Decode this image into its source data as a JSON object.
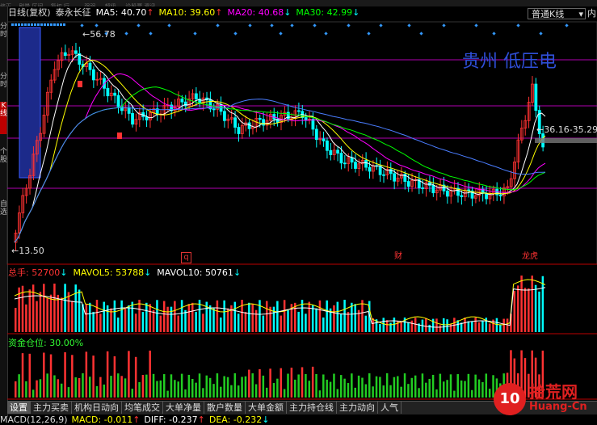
{
  "window": {
    "top_menu": [
      "修正",
      "…刷量",
      "区间…",
      "复权",
      "行…",
      "…",
      "强弱",
      "…",
      "超级",
      "…",
      "论股票",
      "资讯",
      "…"
    ]
  },
  "left_sidebar": {
    "items": [
      {
        "label": "分时",
        "active": false
      },
      {
        "label": "分时",
        "active": false
      },
      {
        "label": "K线",
        "active": true
      },
      {
        "label": "个股",
        "active": false
      },
      {
        "label": "自选",
        "active": false
      }
    ]
  },
  "header": {
    "period": "日线(复权)",
    "stock_name": "泰永长征",
    "ma5": {
      "label": "MA5:",
      "value": "40.70",
      "arrow": "↑",
      "color": "#ffffff"
    },
    "ma10": {
      "label": "MA10:",
      "value": "39.60",
      "arrow": "↑",
      "color": "#ffff00"
    },
    "ma20": {
      "label": "MA20:",
      "value": "40.68",
      "arrow": "↓",
      "color": "#ff00ff"
    },
    "ma30": {
      "label": "MA30:",
      "value": "42.99",
      "arrow": "↓",
      "color": "#00ff00"
    },
    "ktype_label": "普通K线",
    "right_button": "内"
  },
  "price_chart": {
    "high_label": "56.78",
    "low_label": "13.50",
    "range_label": "36.16-35.29",
    "overlay_text": "贵州  低压电",
    "markers": [
      "q",
      "财",
      "龙虎"
    ],
    "colors": {
      "up": "#ff3232",
      "down": "#00ffff",
      "ma5": "#ffffff",
      "ma10": "#ffff00",
      "ma20": "#ff00ff",
      "ma30": "#00ff00",
      "ma60": "#4a7dff",
      "hline": "#b000b0"
    }
  },
  "volume_panel": {
    "label": "总手:",
    "value": "52700",
    "value_arrow": "↓",
    "mavol5_label": "MAVOL5:",
    "mavol5_value": "53788",
    "mavol5_arrow": "↓",
    "mavol10_label": "MAVOL10:",
    "mavol10_value": "50761",
    "mavol10_arrow": "↓"
  },
  "fund_panel": {
    "label": "资金仓位:",
    "value": "30.00%"
  },
  "tabs": [
    "设置",
    "主力买卖",
    "机构日动向",
    "均笔成交",
    "大单净量",
    "散户数量",
    "大单金额",
    "主力持仓线",
    "主力动向",
    "人气"
  ],
  "macd": {
    "label": "MACD(12,26,9)",
    "macd_label": "MACD:",
    "macd_value": "-0.011",
    "macd_arrow": "↑",
    "diff_label": "DIFF:",
    "diff_value": "-0.237",
    "diff_arrow": "↑",
    "dea_label": "DEA:",
    "dea_value": "-0.232",
    "dea_arrow": "↓"
  },
  "watermark": {
    "logo": "10",
    "cn": "拾荒网",
    "url": "Huang-Cn"
  }
}
